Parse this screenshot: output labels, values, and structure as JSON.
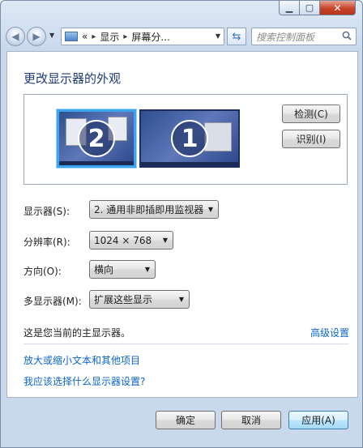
{
  "navigation": {
    "address_prefix": "«",
    "address_parts": [
      "显示",
      "屏幕分..."
    ],
    "address_separator": "▸",
    "search_placeholder": "搜索控制面板"
  },
  "main": {
    "heading": "更改显示器的外观",
    "monitors": [
      {
        "number": "2",
        "selected": true
      },
      {
        "number": "1",
        "selected": false
      }
    ],
    "detect_button": "检测(C)",
    "identify_button": "识别(I)",
    "fields": {
      "display_label": "显示器(S):",
      "display_value": "2. 通用非即插即用监视器",
      "resolution_label": "分辨率(R):",
      "resolution_value": "1024 × 768",
      "orientation_label": "方向(O):",
      "orientation_value": "横向",
      "multi_label": "多显示器(M):",
      "multi_value": "扩展这些显示"
    },
    "status_text": "这是您当前的主显示器。",
    "advanced_link": "高级设置",
    "text_size_link": "放大或缩小文本和其他项目",
    "help_link": "我应该选择什么显示器设置?"
  },
  "footer": {
    "ok_button": "确定",
    "cancel_button": "取消",
    "apply_button": "应用(A)"
  },
  "colors": {
    "heading": "#1e3a78",
    "link": "#0b66c6",
    "selected_monitor_border": "#3da5f0",
    "close_button": "#c7432a"
  }
}
